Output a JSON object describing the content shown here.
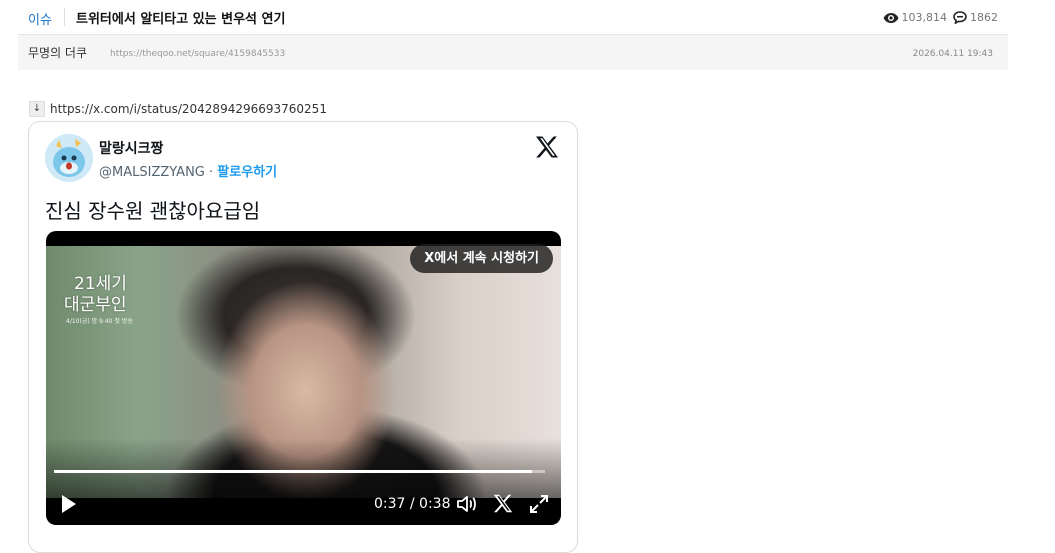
{
  "post": {
    "category": "이슈",
    "title": "트위터에서 알티타고 있는 변우석 연기",
    "views": "103,814",
    "comments": "1862",
    "author": "무명의 더쿠",
    "source_url": "https://theqoo.net/square/4159845533",
    "date": "2026.04.11 19:43"
  },
  "embed": {
    "arrow": "↓",
    "link": "https://x.com/i/status/2042894296693760251"
  },
  "tweet": {
    "display_name": "말랑시크짱",
    "handle": "@MALSIZZYANG",
    "separator": " · ",
    "follow_label": "팔로우하기",
    "text": "진심 장수원 괜찮아요급임",
    "video": {
      "watch_on_x_label": "X에서 계속 시청하기",
      "overlay_title_line1": "21세기",
      "overlay_title_line2": "대군부인",
      "overlay_airtime": "4/10(금) 밤 9:40 첫 방송",
      "time": "0:37 / 0:38",
      "progress": 0.974
    }
  },
  "icons": {
    "views": "eye-icon",
    "comments": "comment-icon",
    "x_logo": "x-logo-icon",
    "play": "play-icon",
    "volume": "volume-icon",
    "fullscreen": "fullscreen-icon"
  },
  "colors": {
    "category_link": "#1a73c9",
    "follow_link": "#1d9bf0"
  }
}
